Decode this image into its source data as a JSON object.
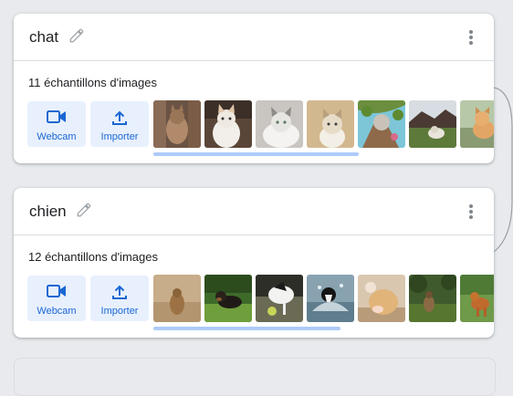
{
  "classes": [
    {
      "title": "chat",
      "samples_label": "11 échantillons d'images",
      "webcam_label": "Webcam",
      "upload_label": "Importer",
      "thumbnails": [
        "cat-photo",
        "cat-photo",
        "cat-photo",
        "cat-photo",
        "cat-photo",
        "cat-photo",
        "cat-photo"
      ]
    },
    {
      "title": "chien",
      "samples_label": "12 échantillons d'images",
      "webcam_label": "Webcam",
      "upload_label": "Importer",
      "thumbnails": [
        "dog-photo",
        "dog-photo",
        "dog-photo",
        "dog-photo",
        "dog-photo",
        "dog-photo",
        "dog-photo"
      ]
    }
  ],
  "icons": {
    "edit": "pencil-icon",
    "menu": "more-vert-icon",
    "webcam": "videocam-icon",
    "upload": "upload-icon"
  },
  "colors": {
    "accent": "#1967d2",
    "button_bg": "#e8f0fe",
    "scroll_thumb": "#aecbfa",
    "page_bg": "#e8eaed"
  }
}
